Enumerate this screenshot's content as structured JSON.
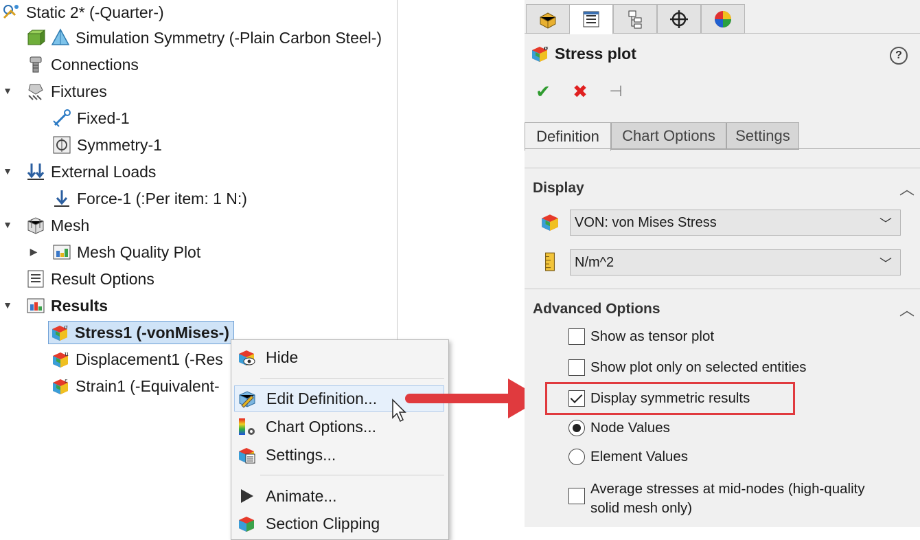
{
  "tree": {
    "items": [
      {
        "label": "Static 2* (-Quarter-)",
        "icon": "study-icon",
        "bold": false
      },
      {
        "label": "Simulation Symmetry (-Plain Carbon Steel-)",
        "icon": "part-material-icon",
        "bold": false
      },
      {
        "label": "Connections",
        "icon": "connections-icon",
        "bold": false
      },
      {
        "label": "Fixtures",
        "icon": "fixtures-icon",
        "bold": false
      },
      {
        "label": "Fixed-1",
        "icon": "fixed-icon",
        "bold": false
      },
      {
        "label": "Symmetry-1",
        "icon": "symmetry-icon",
        "bold": false
      },
      {
        "label": "External Loads",
        "icon": "external-loads-icon",
        "bold": false
      },
      {
        "label": "Force-1 (:Per item: 1 N:)",
        "icon": "force-icon",
        "bold": false
      },
      {
        "label": "Mesh",
        "icon": "mesh-icon",
        "bold": false
      },
      {
        "label": "Mesh Quality Plot",
        "icon": "plot-folder-icon",
        "bold": false
      },
      {
        "label": "Result Options",
        "icon": "result-options-icon",
        "bold": false
      },
      {
        "label": "Results",
        "icon": "results-folder-icon",
        "bold": true
      },
      {
        "label": "Stress1 (-vonMises-)",
        "icon": "stress-plot-icon",
        "bold": true
      },
      {
        "label": "Displacement1 (-Res",
        "icon": "displacement-plot-icon",
        "bold": false
      },
      {
        "label": "Strain1 (-Equivalent-",
        "icon": "strain-plot-icon",
        "bold": false
      }
    ]
  },
  "context_menu": {
    "items": [
      {
        "label": "Hide",
        "icon": "hide-icon"
      },
      {
        "label": "Edit Definition...",
        "icon": "edit-definition-icon"
      },
      {
        "label": "Chart Options...",
        "icon": "chart-options-icon"
      },
      {
        "label": "Settings...",
        "icon": "settings-icon"
      },
      {
        "label": "Animate...",
        "icon": "play-icon"
      },
      {
        "label": "Section Clipping",
        "icon": "section-clipping-icon"
      }
    ]
  },
  "property_manager": {
    "title": "Stress plot",
    "help": "?",
    "tabs": [
      "Definition",
      "Chart Options",
      "Settings"
    ],
    "display": {
      "header": "Display",
      "component": "VON: von Mises Stress",
      "units": "N/m^2"
    },
    "advanced": {
      "header": "Advanced Options",
      "show_tensor": {
        "label": "Show as tensor plot",
        "checked": false
      },
      "show_selected": {
        "label": "Show plot only on selected entities",
        "checked": false
      },
      "display_symmetric": {
        "label": "Display symmetric results",
        "checked": true
      },
      "node_values": {
        "label": "Node Values",
        "selected": true
      },
      "element_values": {
        "label": "Element Values",
        "selected": false
      },
      "average_stresses": {
        "label": "Average stresses at mid-nodes (high-quality solid mesh only)",
        "checked": false
      }
    }
  },
  "colors": {
    "highlight": "#e03a3e",
    "selection": "#cfe3f7",
    "ok": "#2f9b2f",
    "cancel": "#e02020"
  }
}
